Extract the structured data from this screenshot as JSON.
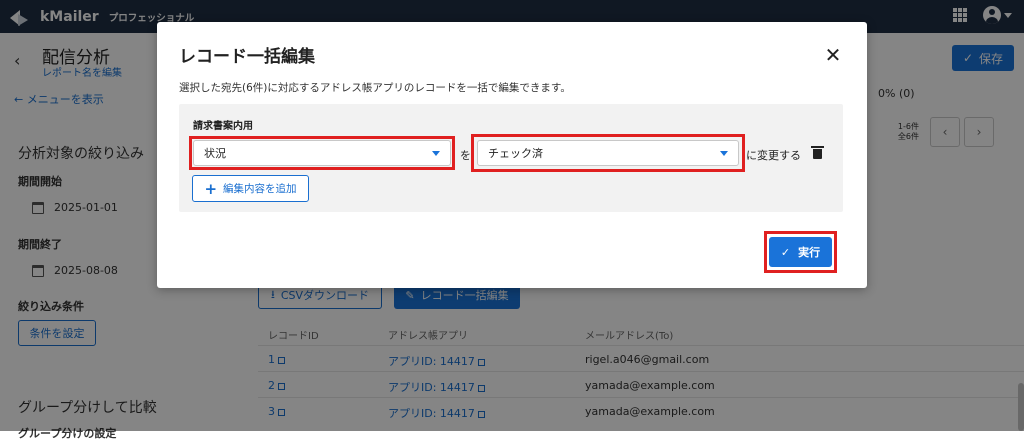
{
  "app": {
    "brand": "kMailer",
    "edition": "プロフェッショナル"
  },
  "page": {
    "back_icon": "arrow-left-icon",
    "title": "配信分析",
    "subtitle": "レポート名を編集",
    "save_label": "保存",
    "menu_link": "メニューを表示",
    "filter_section": "分析対象の絞り込み",
    "start_label": "期間開始",
    "start_date": "2025-01-01",
    "end_label": "期間終了",
    "end_date": "2025-08-08",
    "condition_label": "絞り込み条件",
    "condition_button": "条件を設定",
    "group_section": "グループ分けして比較",
    "group_sub": "グループ分けの設定",
    "percent": "0% (0)",
    "pager_range": "1-6件",
    "pager_total": "全6件",
    "csv_button": "CSVダウンロード",
    "bulk_button": "レコード一括編集",
    "table": {
      "headers": [
        "レコードID",
        "アドレス帳アプリ",
        "メールアドレス(To)"
      ],
      "rows": [
        {
          "id": "1",
          "app": "アプリID: 14417",
          "mail": "rigel.a046@gmail.com"
        },
        {
          "id": "2",
          "app": "アプリID: 14417",
          "mail": "yamada@example.com"
        },
        {
          "id": "3",
          "app": "アプリID: 14417",
          "mail": "yamada@example.com"
        }
      ]
    }
  },
  "modal": {
    "title": "レコード一括編集",
    "description": "選択した宛先(6件)に対応するアドレス帳アプリのレコードを一括で編集できます。",
    "field_title": "請求書案内用",
    "field_select_value": "状況",
    "connector": "を",
    "value_select_value": "チェック済",
    "change_suffix": "に変更する",
    "add_button": "編集内容を追加",
    "execute_button": "実行",
    "close_symbol": "✕"
  },
  "icons": {
    "close": "close-icon",
    "trash": "trash-icon",
    "check": "check-icon",
    "plus": "plus-icon",
    "apps": "apps-grid-icon",
    "account": "account-icon"
  },
  "colors": {
    "topbar": "#1f2e44",
    "primary": "#1a73d9",
    "highlight": "#e02020",
    "panel": "#f2f2f2"
  }
}
